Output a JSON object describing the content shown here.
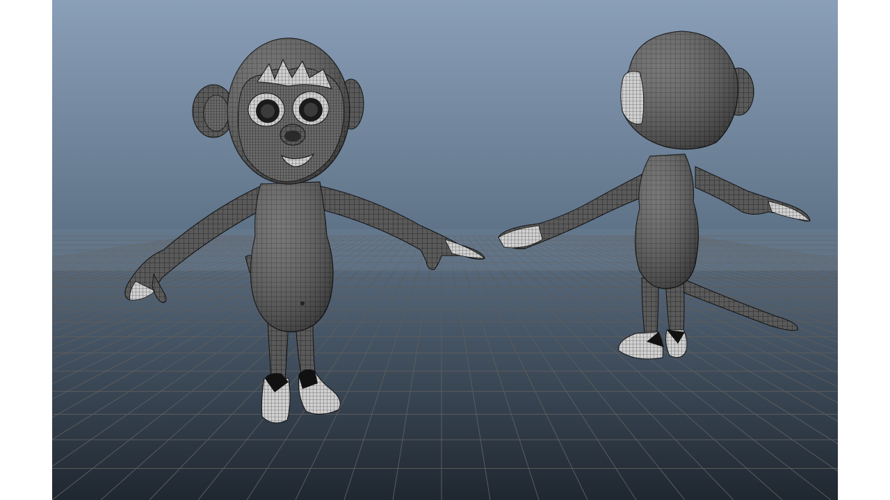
{
  "viewport": {
    "background_top": "#8a9fb8",
    "background_bottom": "#1f2730",
    "grid_color": "#5c5c5c",
    "mesh_fill": "#5a5a5a",
    "wire_color": "#1a1a1a",
    "highlight_color": "#d9d9d9"
  },
  "models": [
    {
      "name": "monkey-front-view"
    },
    {
      "name": "monkey-back-view"
    }
  ]
}
